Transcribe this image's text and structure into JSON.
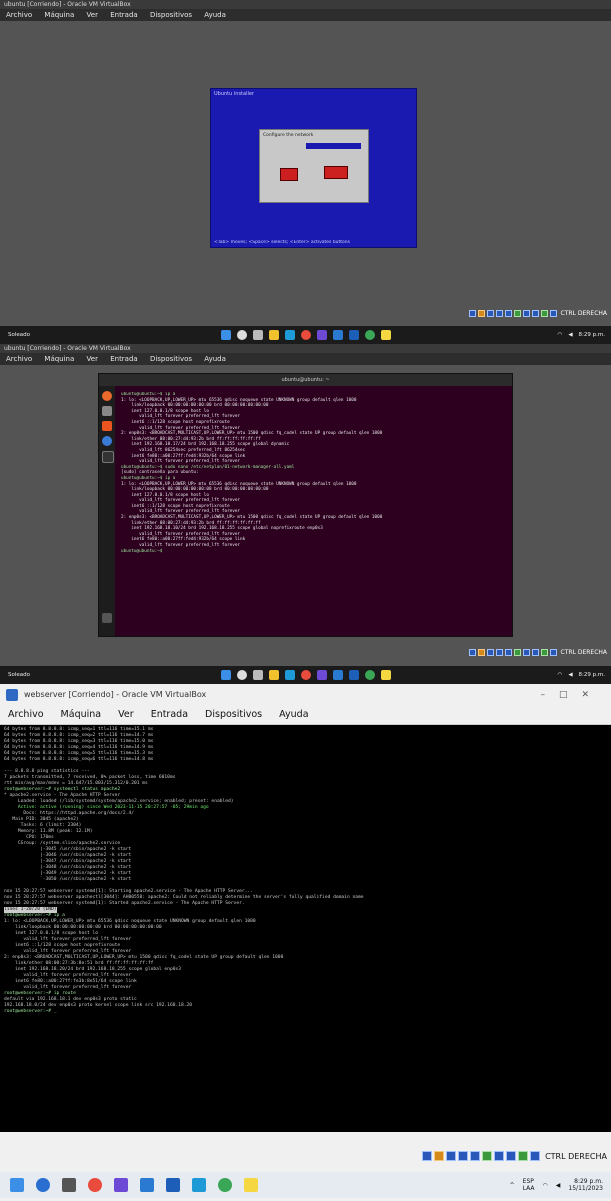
{
  "shot1": {
    "title": "ubuntu [Corriendo] - Oracle VM VirtualBox",
    "menu": [
      "Archivo",
      "Máquina",
      "Ver",
      "Entrada",
      "Dispositivos",
      "Ayuda"
    ],
    "installer_header": "Ubuntu installer",
    "dialog_text": "Configure the network",
    "status_hint": "<Tab> moves; <Space> selects; <Enter> activates buttons",
    "hostkey": "CTRL DERECHA",
    "weather": "Soleado",
    "clock": "8:29 p.m."
  },
  "shot2": {
    "title": "ubuntu [Corriendo] - Oracle VM VirtualBox",
    "menu": [
      "Archivo",
      "Máquina",
      "Ver",
      "Entrada",
      "Dispositivos",
      "Ayuda"
    ],
    "terminal_title": "ubuntu@ubuntu: ~",
    "terminal_lines": [
      "ubuntu@ubuntu:~$ ip a",
      "1: lo: <LOOPBACK,UP,LOWER_UP> mtu 65536 qdisc noqueue state UNKNOWN group default qlen 1000",
      "    link/loopback 00:00:00:00:00:00 brd 00:00:00:00:00:00",
      "    inet 127.0.0.1/8 scope host lo",
      "       valid_lft forever preferred_lft forever",
      "    inet6 ::1/128 scope host noprefixroute",
      "       valid_lft forever preferred_lft forever",
      "2: enp0s3: <BROADCAST,MULTICAST,UP,LOWER_UP> mtu 1500 qdisc fq_codel state UP group default qlen 1000",
      "    link/ether 08:00:27:d4:93:2b brd ff:ff:ff:ff:ff:ff",
      "    inet 192.168.18.17/24 brd 192.168.18.255 scope global dynamic",
      "       valid_lft 86254sec preferred_lft 86254sec",
      "    inet6 fe80::a00:27ff:fed4:932b/64 scope link",
      "       valid_lft forever preferred_lft forever",
      "ubuntu@ubuntu:~$ sudo nano /etc/netplan/01-network-manager-all.yaml",
      "[sudo] contraseña para ubuntu:",
      "ubuntu@ubuntu:~$ ip a",
      "1: lo: <LOOPBACK,UP,LOWER_UP> mtu 65536 qdisc noqueue state UNKNOWN group default qlen 1000",
      "    link/loopback 00:00:00:00:00:00 brd 00:00:00:00:00:00",
      "    inet 127.0.0.1/8 scope host lo",
      "       valid_lft forever preferred_lft forever",
      "    inet6 ::1/128 scope host noprefixroute",
      "       valid_lft forever preferred_lft forever",
      "2: enp0s3: <BROADCAST,MULTICAST,UP,LOWER_UP> mtu 1500 qdisc fq_codel state UP group default qlen 1000",
      "    link/ether 08:00:27:d4:93:2b brd ff:ff:ff:ff:ff:ff",
      "    inet 192.168.18.10/24 brd 192.168.18.255 scope global noprefixroute enp0s3",
      "       valid_lft forever preferred_lft forever",
      "    inet6 fe80::a00:27ff:fed4:932b/64 scope link",
      "       valid_lft forever preferred_lft forever",
      "ubuntu@ubuntu:~$ "
    ],
    "hostkey": "CTRL DERECHA",
    "weather": "Soleado",
    "clock": "8:29 p.m."
  },
  "shot3": {
    "title": "webserver [Corriendo] - Oracle VM VirtualBox",
    "menu": [
      "Archivo",
      "Máquina",
      "Ver",
      "Entrada",
      "Dispositivos",
      "Ayuda"
    ],
    "console_lines": [
      "64 bytes from 8.8.8.8: icmp_seq=1 ttl=116 time=15.1 ms",
      "64 bytes from 8.8.8.8: icmp_seq=2 ttl=116 time=14.7 ms",
      "64 bytes from 8.8.8.8: icmp_seq=3 ttl=116 time=15.0 ms",
      "64 bytes from 8.8.8.8: icmp_seq=4 ttl=116 time=14.9 ms",
      "64 bytes from 8.8.8.8: icmp_seq=5 ttl=116 time=15.3 ms",
      "64 bytes from 8.8.8.8: icmp_seq=6 ttl=116 time=14.8 ms",
      "",
      "--- 8.8.8.8 ping statistics ---",
      "7 packets transmitted, 7 received, 0% packet loss, time 6010ms",
      "rtt min/avg/max/mdev = 14.647/15.003/15.312/0.201 ms",
      "root@webserver:~# systemctl status apache2",
      "* apache2.service - The Apache HTTP Server",
      "     Loaded: loaded (/lib/systemd/system/apache2.service; enabled; preset: enabled)",
      "     Active: active (running) since Wed 2023-11-15 20:27:57 -05; 29min ago",
      "       Docs: https://httpd.apache.org/docs/2.4/",
      "   Main PID: 3045 (apache2)",
      "      Tasks: 6 (limit: 2304)",
      "     Memory: 11.8M (peak: 12.1M)",
      "        CPU: 170ms",
      "     CGroup: /system.slice/apache2.service",
      "             |-3045 /usr/sbin/apache2 -k start",
      "             |-3046 /usr/sbin/apache2 -k start",
      "             |-3047 /usr/sbin/apache2 -k start",
      "             |-3048 /usr/sbin/apache2 -k start",
      "             |-3049 /usr/sbin/apache2 -k start",
      "             `-3050 /usr/sbin/apache2 -k start",
      "",
      "nov 15 20:27:57 webserver systemd[1]: Starting apache2.service - The Apache HTTP Server...",
      "nov 15 20:27:57 webserver apachectl[3044]: AH00558: apache2: Could not reliably determine the server's fully qualified domain name",
      "nov 15 20:27:57 webserver systemd[1]: Started apache2.service - The Apache HTTP Server.",
      "lines 1-20/20 (END)",
      "root@webserver:~# ip a",
      "1: lo: <LOOPBACK,UP,LOWER_UP> mtu 65536 qdisc noqueue state UNKNOWN group default qlen 1000",
      "    link/loopback 00:00:00:00:00:00 brd 00:00:00:00:00:00",
      "    inet 127.0.0.1/8 scope host lo",
      "       valid_lft forever preferred_lft forever",
      "    inet6 ::1/128 scope host noprefixroute",
      "       valid_lft forever preferred_lft forever",
      "2: enp0s3: <BROADCAST,MULTICAST,UP,LOWER_UP> mtu 1500 qdisc fq_codel state UP group default qlen 1000",
      "    link/ether 08:00:27:3b:8e:51 brd ff:ff:ff:ff:ff:ff",
      "    inet 192.168.18.20/24 brd 192.168.18.255 scope global enp0s3",
      "       valid_lft forever preferred_lft forever",
      "    inet6 fe80::a00:27ff:fe3b:8e51/64 scope link",
      "       valid_lft forever preferred_lft forever",
      "root@webserver:~# ip route",
      "default via 192.168.18.1 dev enp0s3 proto static",
      "192.168.18.0/24 dev enp0s3 proto kernel scope link src 192.168.18.20",
      "root@webserver:~# _"
    ],
    "hostkey": "CTRL DERECHA",
    "lang": "ESP",
    "lang2": "LAA",
    "clock": "8:29 p.m.",
    "date": "15/11/2023"
  },
  "colors": {
    "installer_blue": "#1a1ab0",
    "terminal_purple": "#2c001e",
    "vm_gray": "#545454"
  }
}
